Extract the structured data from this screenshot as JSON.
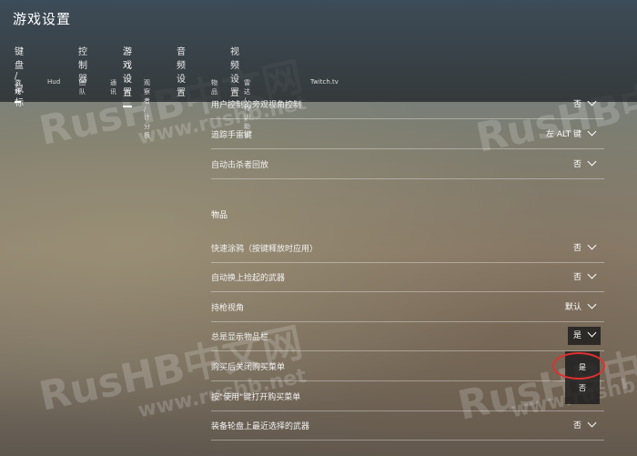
{
  "title": "游戏设置",
  "tabs": [
    "键盘 / 鼠标",
    "控制器",
    "游戏设置",
    "音频设置",
    "视频设置"
  ],
  "active_tab": 2,
  "subtabs": [
    "游戏",
    "Hud",
    "团队",
    "通讯",
    "观察者 / 计分板",
    "物品",
    "雷达 / 特训助手",
    "Twitch.tv"
  ],
  "active_subtab": 0,
  "rows_top": [
    {
      "label": "用户控制的旁观视角控制",
      "value": "否"
    },
    {
      "label": "追踪手雷键",
      "value": "左 ALT 键"
    },
    {
      "label": "自动击杀者回放",
      "value": "否"
    }
  ],
  "section_title": "物品",
  "rows_items": [
    {
      "label": "快速涂鸦（按键释放时应用）",
      "value": "否"
    },
    {
      "label": "自动换上捡起的武器",
      "value": "否"
    },
    {
      "label": "持枪视角",
      "value": "默认"
    },
    {
      "label": "总是显示物品栏",
      "value": "是"
    },
    {
      "label": "购买后关闭购买菜单",
      "value": ""
    },
    {
      "label": "按\"使用\"键打开购买菜单",
      "value": ""
    },
    {
      "label": "装备轮盘上最近选择的武器",
      "value": "否"
    }
  ],
  "dropdown_options": [
    "是",
    "否"
  ],
  "watermark": {
    "logo": "RusHB中文网",
    "url": "www.rushb.net"
  }
}
